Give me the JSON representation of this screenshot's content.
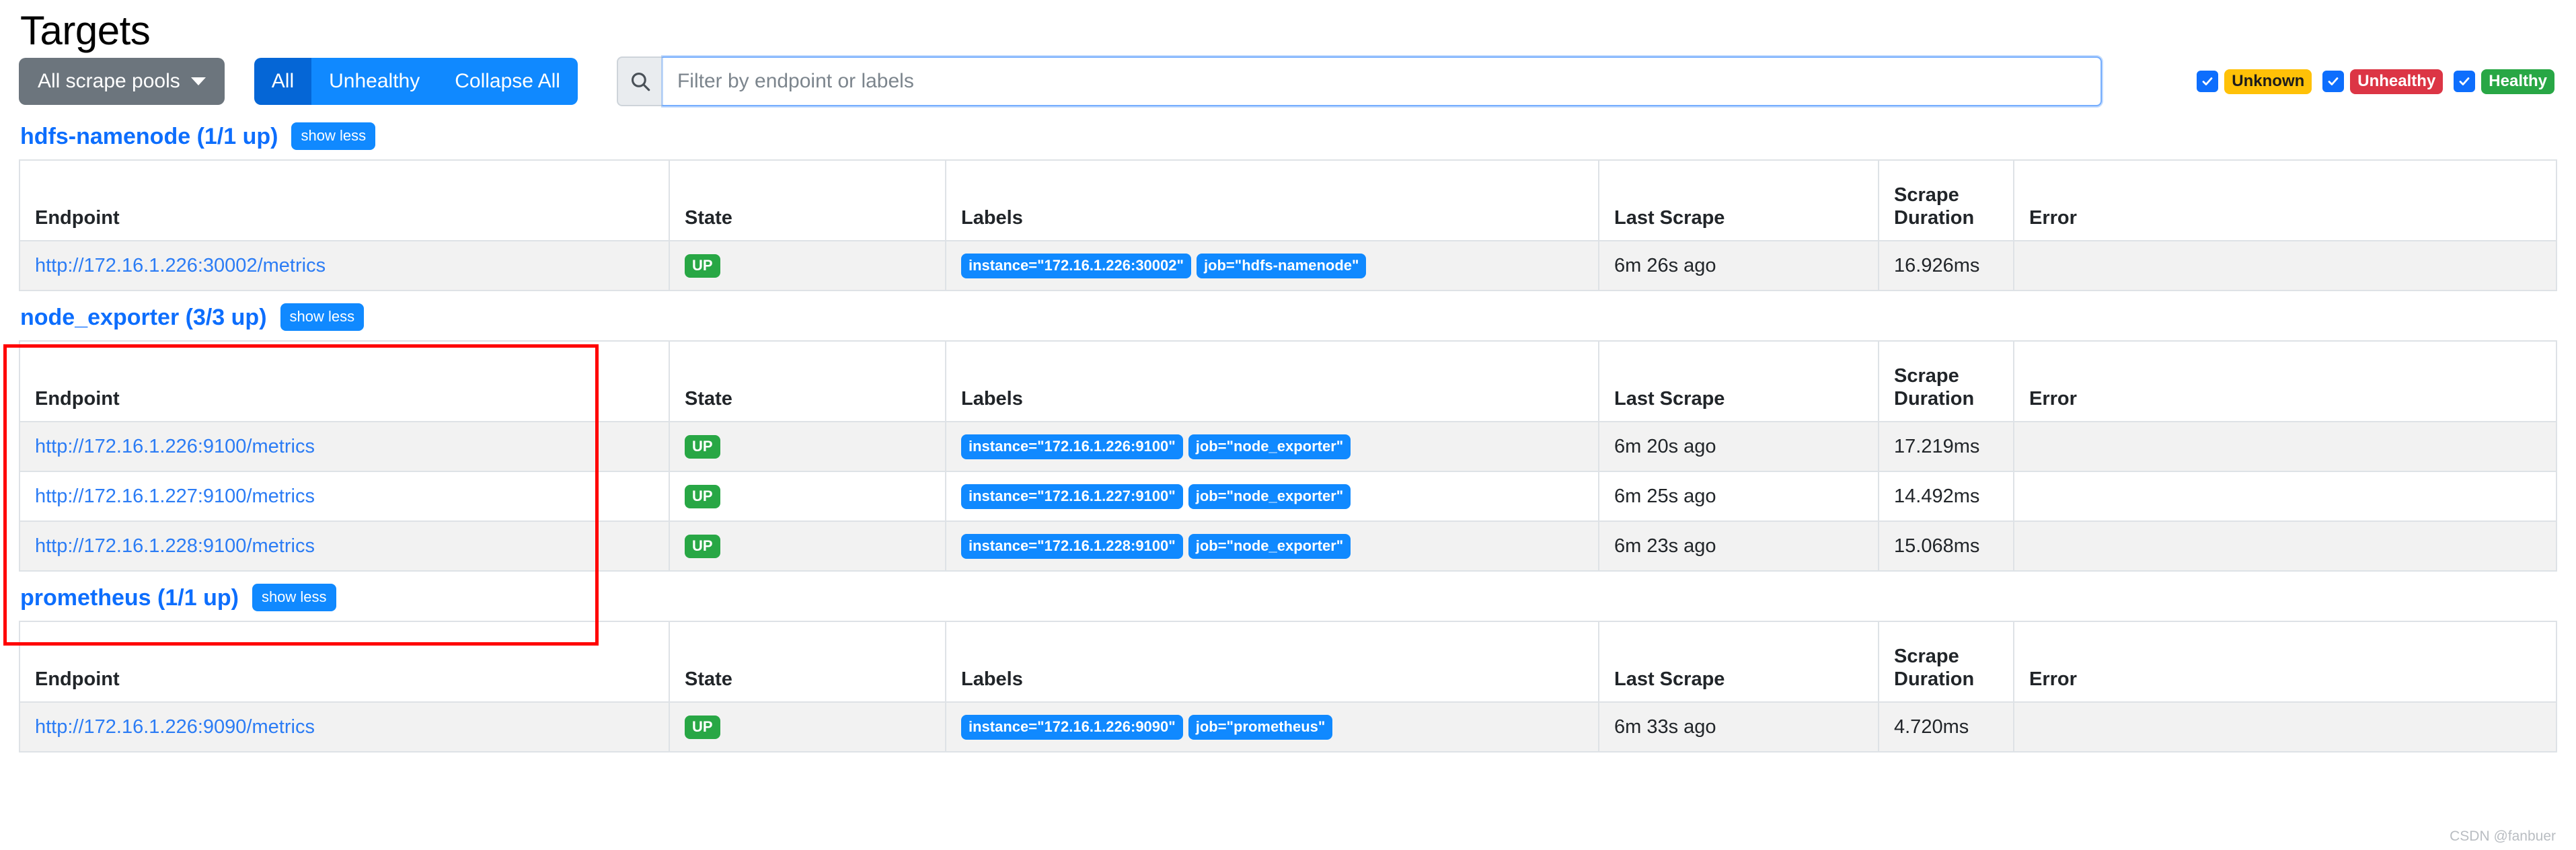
{
  "header": {
    "title": "Targets"
  },
  "toolbar": {
    "pool_dropdown_label": "All scrape pools",
    "buttons": [
      {
        "label": "All",
        "active": true
      },
      {
        "label": "Unhealthy",
        "active": false
      },
      {
        "label": "Collapse All",
        "active": false
      }
    ],
    "search": {
      "placeholder": "Filter by endpoint or labels",
      "value": "",
      "icon": "search-icon"
    },
    "status_filters": [
      {
        "label": "Unknown",
        "checked": true,
        "color": "#ffc107"
      },
      {
        "label": "Unhealthy",
        "checked": true,
        "color": "#dc3545"
      },
      {
        "label": "Healthy",
        "checked": true,
        "color": "#28a745"
      }
    ]
  },
  "table_headers": {
    "endpoint": "Endpoint",
    "state": "State",
    "labels": "Labels",
    "last_scrape": "Last Scrape",
    "scrape_duration": "Scrape Duration",
    "error": "Error"
  },
  "show_less_label": "show less",
  "pools": [
    {
      "title": "hdfs-namenode (1/1 up)",
      "name": "hdfs-namenode",
      "up": "1/1",
      "highlighted": false,
      "rows": [
        {
          "endpoint": "http://172.16.1.226:30002/metrics",
          "state": "UP",
          "labels": [
            "instance=\"172.16.1.226:30002\"",
            "job=\"hdfs-namenode\""
          ],
          "last_scrape": "6m 26s ago",
          "scrape_duration": "16.926ms",
          "error": ""
        }
      ]
    },
    {
      "title": "node_exporter (3/3 up)",
      "name": "node_exporter",
      "up": "3/3",
      "highlighted": true,
      "rows": [
        {
          "endpoint": "http://172.16.1.226:9100/metrics",
          "state": "UP",
          "labels": [
            "instance=\"172.16.1.226:9100\"",
            "job=\"node_exporter\""
          ],
          "last_scrape": "6m 20s ago",
          "scrape_duration": "17.219ms",
          "error": ""
        },
        {
          "endpoint": "http://172.16.1.227:9100/metrics",
          "state": "UP",
          "labels": [
            "instance=\"172.16.1.227:9100\"",
            "job=\"node_exporter\""
          ],
          "last_scrape": "6m 25s ago",
          "scrape_duration": "14.492ms",
          "error": ""
        },
        {
          "endpoint": "http://172.16.1.228:9100/metrics",
          "state": "UP",
          "labels": [
            "instance=\"172.16.1.228:9100\"",
            "job=\"node_exporter\""
          ],
          "last_scrape": "6m 23s ago",
          "scrape_duration": "15.068ms",
          "error": ""
        }
      ]
    },
    {
      "title": "prometheus (1/1 up)",
      "name": "prometheus",
      "up": "1/1",
      "highlighted": false,
      "rows": [
        {
          "endpoint": "http://172.16.1.226:9090/metrics",
          "state": "UP",
          "labels": [
            "instance=\"172.16.1.226:9090\"",
            "job=\"prometheus\""
          ],
          "last_scrape": "6m 33s ago",
          "scrape_duration": "4.720ms",
          "error": ""
        }
      ]
    }
  ],
  "watermark": "CSDN @fanbuer"
}
